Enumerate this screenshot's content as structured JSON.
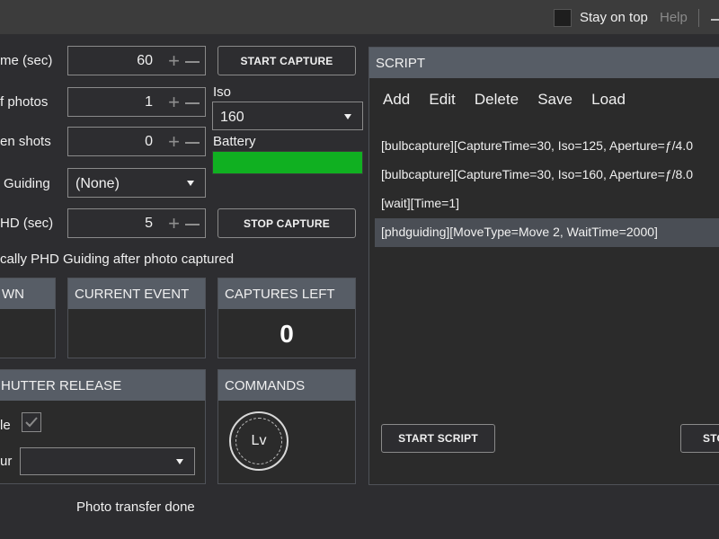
{
  "titlebar": {
    "stay_on_top_label": "Stay on top",
    "help_label": "Help"
  },
  "fields": {
    "exposure_time_label": "me (sec)",
    "exposure_time_value": "60",
    "num_photos_label": "f photos",
    "num_photos_value": "1",
    "between_shots_label": "en shots",
    "between_shots_value": "0",
    "guiding_label": "Guiding",
    "guiding_value": "(None)",
    "phd_label": "HD (sec)",
    "phd_value": "5",
    "iso_label": "Iso",
    "iso_value": "160",
    "battery_label": "Battery",
    "battery_color": "#10b021",
    "phd_auto_text": "cally PHD Guiding after photo captured"
  },
  "buttons": {
    "start_capture": "START CAPTURE",
    "stop_capture": "STOP CAPTURE",
    "start_script": "START SCRIPT",
    "stop_script_partial": "STO"
  },
  "panels": {
    "countdown_title": "WN",
    "current_event_title": "CURRENT EVENT",
    "captures_left_title": "CAPTURES LEFT",
    "captures_left_value": "0",
    "shutter_release_title": "HUTTER RELEASE",
    "commands_title": "COMMANDS",
    "enable_label_partial": "le",
    "port_label_partial": "ur",
    "live_view_label": "Lv"
  },
  "script": {
    "title": "SCRIPT",
    "menu": [
      "Add",
      "Edit",
      "Delete",
      "Save",
      "Load"
    ],
    "lines": [
      "[bulbcapture][CaptureTime=30, Iso=125, Aperture=ƒ/4.0",
      "[bulbcapture][CaptureTime=30, Iso=160, Aperture=ƒ/8.0",
      "[wait][Time=1]",
      "[phdguiding][MoveType=Move 2, WaitTime=2000]"
    ],
    "selected_index": 3
  },
  "status": {
    "message": "Photo transfer done"
  },
  "colors": {
    "background": "#2d2d30",
    "panel_header": "#575d66",
    "selection": "#4a4e55",
    "accent_green": "#10b021"
  }
}
